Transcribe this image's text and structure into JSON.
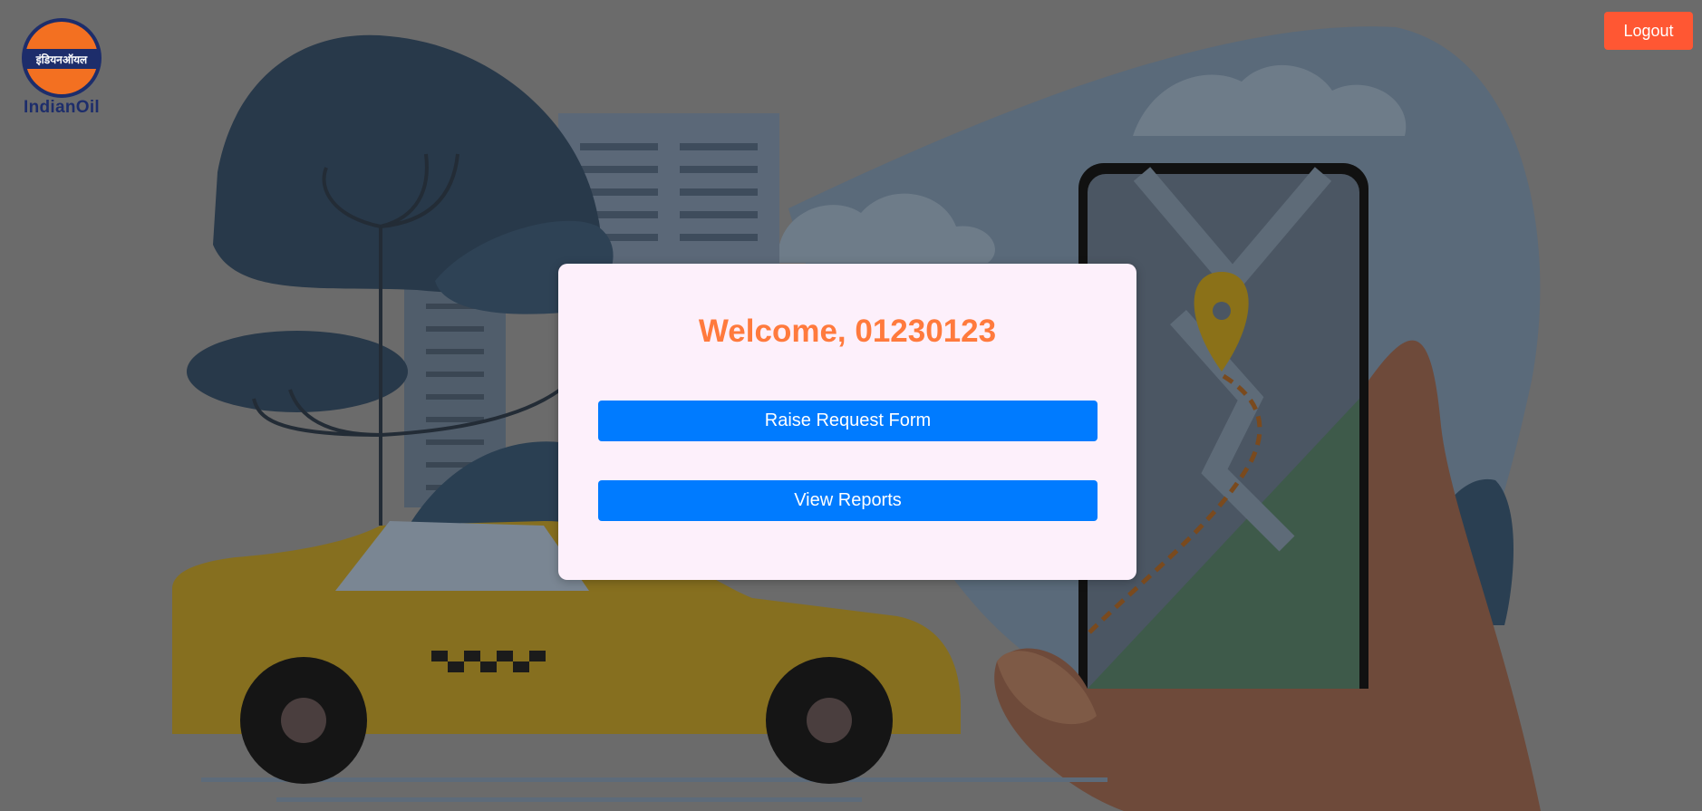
{
  "brand": {
    "logo_name": "IndianOil",
    "logo_script": "इंडियनऑयल"
  },
  "header": {
    "logout_label": "Logout"
  },
  "card": {
    "welcome": "Welcome, 01230123",
    "raise_request_label": "Raise Request Form",
    "view_reports_label": "View Reports"
  },
  "colors": {
    "accent_orange": "#ff7a3d",
    "logout_bg": "#ff5733",
    "primary_blue": "#007bff",
    "card_bg": "#fdf0fb"
  }
}
